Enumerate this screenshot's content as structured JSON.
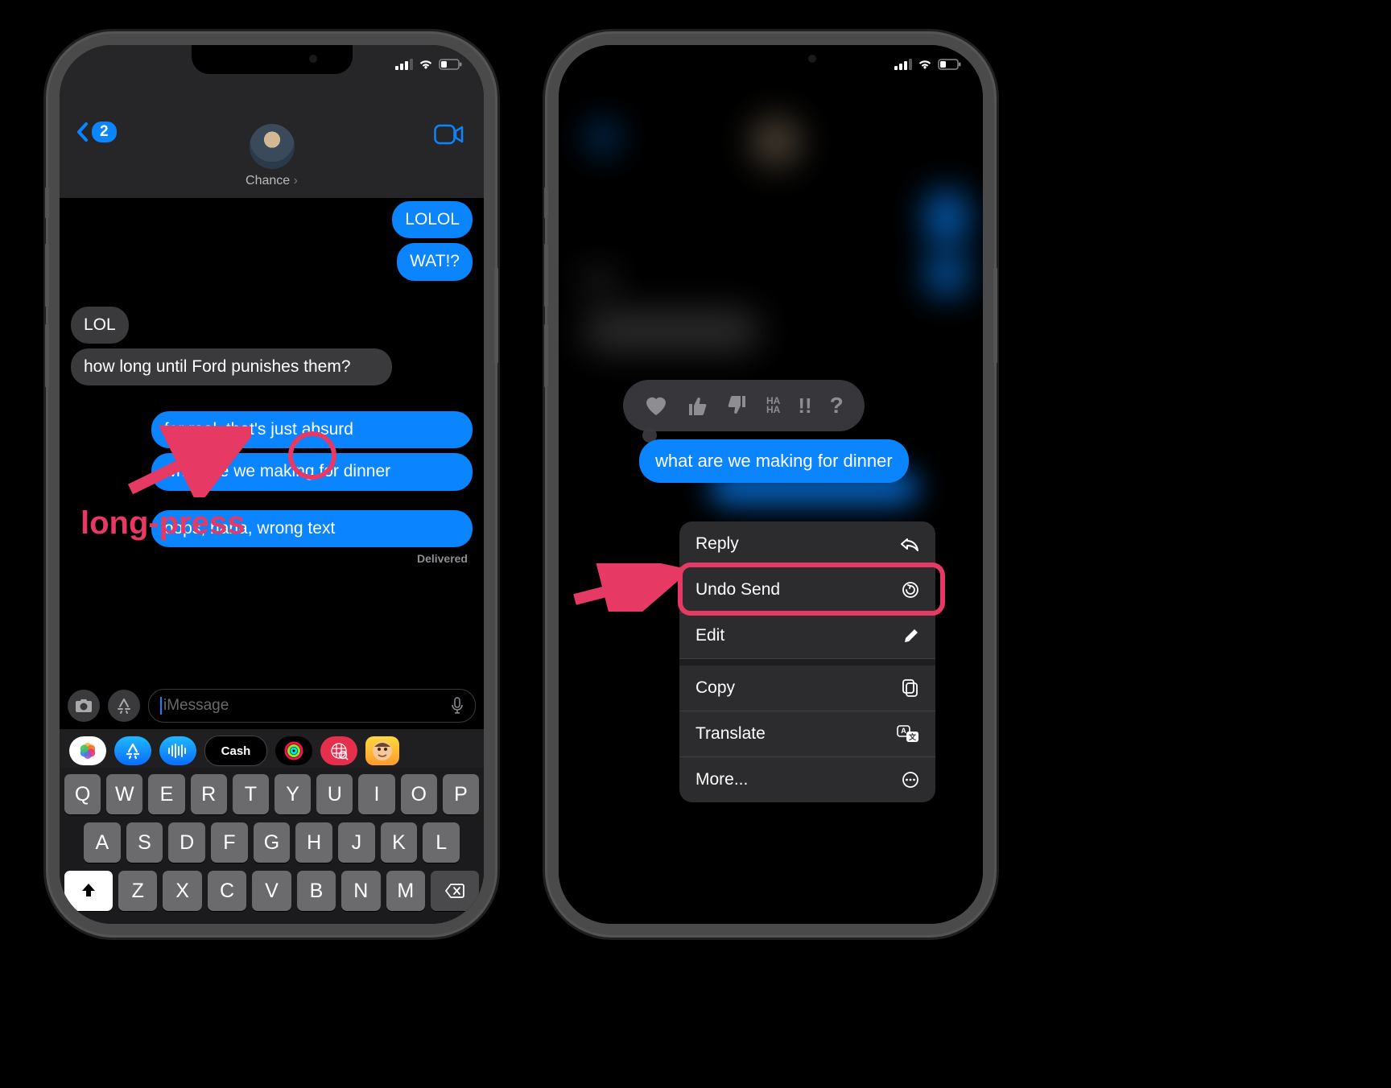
{
  "statusbar": {
    "signal": 3,
    "wifi": true,
    "battery": 25
  },
  "phone1": {
    "header": {
      "back_count": "2",
      "contact_name": "Chance"
    },
    "messages": {
      "sent1": "LOLOL",
      "sent2": "WAT!?",
      "recv1": "LOL",
      "recv2": "how long until Ford punishes them?",
      "sent3": "for real, that's just absurd",
      "sent4": "what are we making for dinner",
      "sent5": "oops, haha, wrong text",
      "delivered": "Delivered"
    },
    "input": {
      "placeholder": "iMessage"
    },
    "app_strip": {
      "cash_label": "Cash"
    },
    "keyboard": {
      "row1": [
        "Q",
        "W",
        "E",
        "R",
        "T",
        "Y",
        "U",
        "I",
        "O",
        "P"
      ],
      "row2": [
        "A",
        "S",
        "D",
        "F",
        "G",
        "H",
        "J",
        "K",
        "L"
      ],
      "row3": [
        "Z",
        "X",
        "C",
        "V",
        "B",
        "N",
        "M"
      ]
    }
  },
  "phone2": {
    "focus_message": "what are we making for dinner",
    "tapbacks": [
      "heart",
      "thumbs-up",
      "thumbs-down",
      "haha",
      "exclaim",
      "question"
    ],
    "haha_label": "HA\nHA",
    "menu": {
      "reply": "Reply",
      "undo_send": "Undo Send",
      "edit": "Edit",
      "copy": "Copy",
      "translate": "Translate",
      "more": "More..."
    }
  },
  "annotations": {
    "long_press": "long-press"
  }
}
